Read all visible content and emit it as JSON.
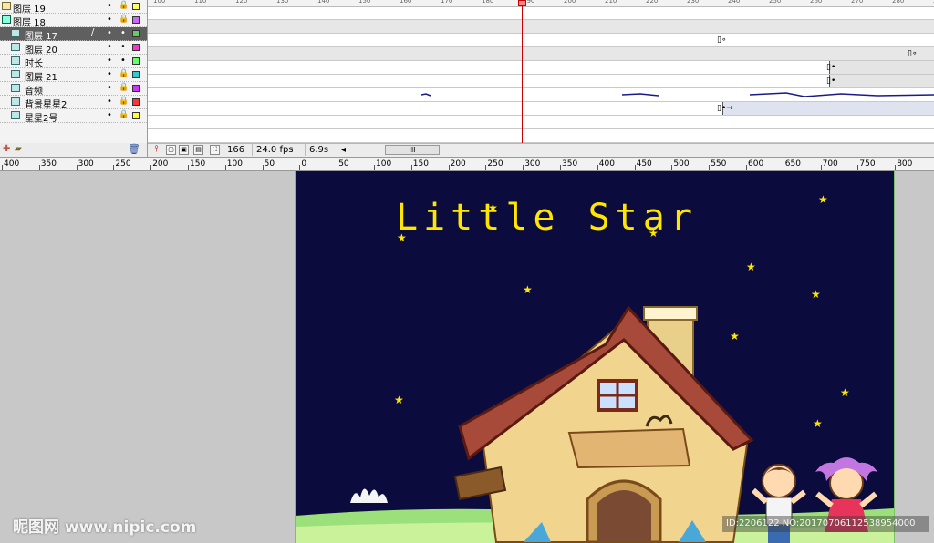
{
  "layers": [
    {
      "name": "图层 19",
      "icon": "folder-icon",
      "color": "#ffff66",
      "selected": false
    },
    {
      "name": "图层 18",
      "icon": "guide-layer-icon",
      "color": "#cc66ff",
      "selected": false
    },
    {
      "name": "图层 17",
      "icon": "layer-icon",
      "color": "#66cc66",
      "selected": true
    },
    {
      "name": "图层 20",
      "icon": "layer-icon",
      "color": "#ff33cc",
      "selected": false
    },
    {
      "name": "时长",
      "icon": "layer-icon",
      "color": "#66ff66",
      "selected": false
    },
    {
      "name": "图层 21",
      "icon": "layer-icon",
      "color": "#33cccc",
      "selected": false
    },
    {
      "name": "音频",
      "icon": "layer-icon",
      "color": "#cc33ff",
      "selected": false
    },
    {
      "name": "背景星星2",
      "icon": "layer-icon",
      "color": "#ff3333",
      "selected": false
    },
    {
      "name": "星星2号",
      "icon": "layer-icon",
      "color": "#ffff33",
      "selected": false
    }
  ],
  "layer_controls": {
    "visible_glyph": "•",
    "lock_glyph": "🔒",
    "edit_glyph": "/"
  },
  "timeline_status": {
    "current_frame": "166",
    "frame_rate": "24.0 fps",
    "elapsed_time": "6.9s",
    "scroll_left_glyph": "◂",
    "scroll_thumb_glyph": "III"
  },
  "frame_ruler_labels": [
    "100",
    "110",
    "120",
    "130",
    "140",
    "150",
    "160",
    "170",
    "180",
    "190",
    "200",
    "210",
    "220",
    "230",
    "240",
    "250",
    "260",
    "270",
    "280",
    "290"
  ],
  "stage_ruler_labels": [
    "400",
    "350",
    "300",
    "250",
    "200",
    "150",
    "100",
    "50",
    "0",
    "50",
    "100",
    "150",
    "200",
    "250",
    "300",
    "350",
    "400",
    "450",
    "500",
    "550",
    "600",
    "650",
    "700",
    "750",
    "800"
  ],
  "stage": {
    "title": "Little Star",
    "background_color": "#0b0b3d",
    "title_color": "#ffe600"
  },
  "watermark": {
    "left_text": "昵图网 www.nipic.com",
    "right_text": "ID:2206122 NO:20170706112538954000"
  },
  "icons": {
    "add_layer": "add-layer-icon",
    "add_folder": "add-folder-icon",
    "delete_layer": "trash-icon",
    "onion_skin": "onion-skin-icon",
    "edit_multiple": "edit-multiple-frames-icon"
  }
}
